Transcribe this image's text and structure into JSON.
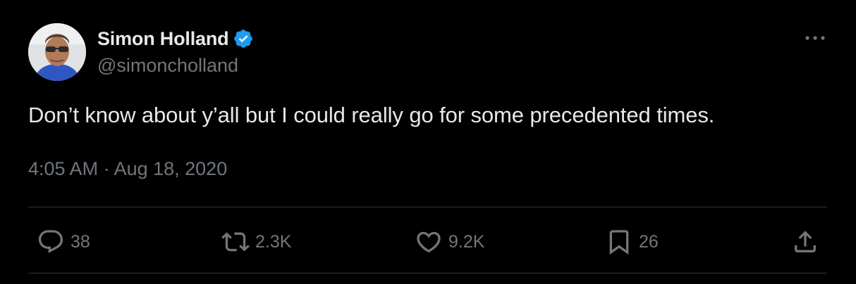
{
  "author": {
    "display_name": "Simon Holland",
    "handle": "@simoncholland",
    "verified": true
  },
  "tweet": {
    "text": "Don’t know about y’all but I could really go for some precedented times.",
    "timestamp": "4:05 AM · Aug 18, 2020"
  },
  "actions": {
    "replies": "38",
    "retweets": "2.3K",
    "likes": "9.2K",
    "bookmarks": "26"
  },
  "icons": {
    "verified": "verified-badge-icon",
    "more": "more-horizontal-icon",
    "reply": "reply-icon",
    "retweet": "retweet-icon",
    "like": "heart-icon",
    "bookmark": "bookmark-icon",
    "share": "share-icon"
  },
  "colors": {
    "background": "#000000",
    "text_primary": "#e7e9ea",
    "text_secondary": "#71767b",
    "verified_blue": "#1d9bf0",
    "divider": "#2f3336"
  }
}
